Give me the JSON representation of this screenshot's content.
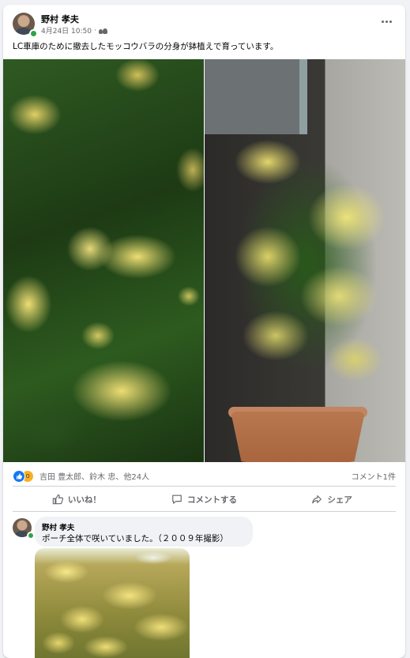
{
  "post": {
    "author": "野村 孝夫",
    "timestamp": "4月24日 10:50",
    "privacy_icon": "friends-icon",
    "more_icon": "more-horizontal-icon",
    "text": "LC車庫のために撤去したモッコウバラの分身が鉢植えで育っています。"
  },
  "photos": [
    {
      "name": "yellow-rose-closeup-photo"
    },
    {
      "name": "potted-yellow-rose-photo"
    }
  ],
  "reactions": {
    "icons": [
      "like-reaction-icon",
      "wow-reaction-icon"
    ],
    "reactors": "吉田 豊太郎、鈴木 忠、他24人",
    "comment_count": "コメント1件"
  },
  "actions": {
    "like": "いいね！",
    "comment": "コメントする",
    "share": "シェア"
  },
  "comment": {
    "author": "野村 孝夫",
    "text": "ポーチ全体で咲いていました。（２００９年撮影）",
    "photo": "porch-rose-photo"
  },
  "colors": {
    "accent": "#1877f2",
    "secondary_text": "#65676b",
    "online": "#31a24c",
    "wow": "#f7b125"
  }
}
